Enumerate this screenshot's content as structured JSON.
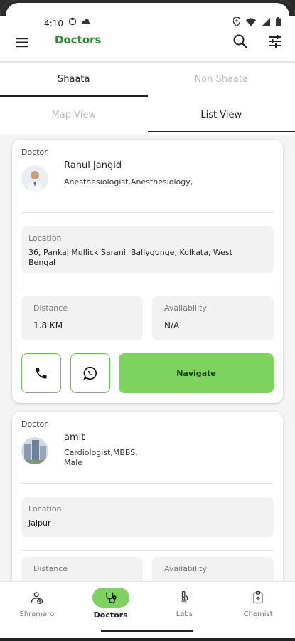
{
  "status_bar": {
    "time": "4:10"
  },
  "app_bar": {
    "title": "Doctors"
  },
  "top_tabs": [
    {
      "label": "Shaata",
      "active": true
    },
    {
      "label": "Non Shaata",
      "active": false
    }
  ],
  "view_tabs": [
    {
      "label": "Map View",
      "active": false
    },
    {
      "label": "List View",
      "active": true
    }
  ],
  "doctors": [
    {
      "type_label": "Doctor",
      "name": "Rahul Jangid",
      "specialty": "Anesthesiologist,Anesthesiology,",
      "location_label": "Location",
      "location": "36, Pankaj Mullick Sarani, Ballygunge, Kolkata, West Bengal",
      "distance_label": "Distance",
      "distance": "1.8 KM",
      "availability_label": "Availability",
      "availability": "N/A",
      "navigate_label": "Navigate"
    },
    {
      "type_label": "Doctor",
      "name": "amit",
      "specialty": "Cardiologist,MBBS, Male",
      "location_label": "Location",
      "location": "Jaipur",
      "distance_label": "Distance",
      "availability_label": "Availability"
    }
  ],
  "bottom_nav": [
    {
      "label": "Shramaro",
      "icon": "person-plus-icon",
      "active": false
    },
    {
      "label": "Doctors",
      "icon": "stethoscope-icon",
      "active": true
    },
    {
      "label": "Labs",
      "icon": "microscope-icon",
      "active": false
    },
    {
      "label": "Chemist",
      "icon": "clipboard-icon",
      "active": false
    }
  ],
  "colors": {
    "brand_green": "#2e8b2e",
    "accent_green": "#7ed35f",
    "outline_green": "#6cc24a"
  }
}
